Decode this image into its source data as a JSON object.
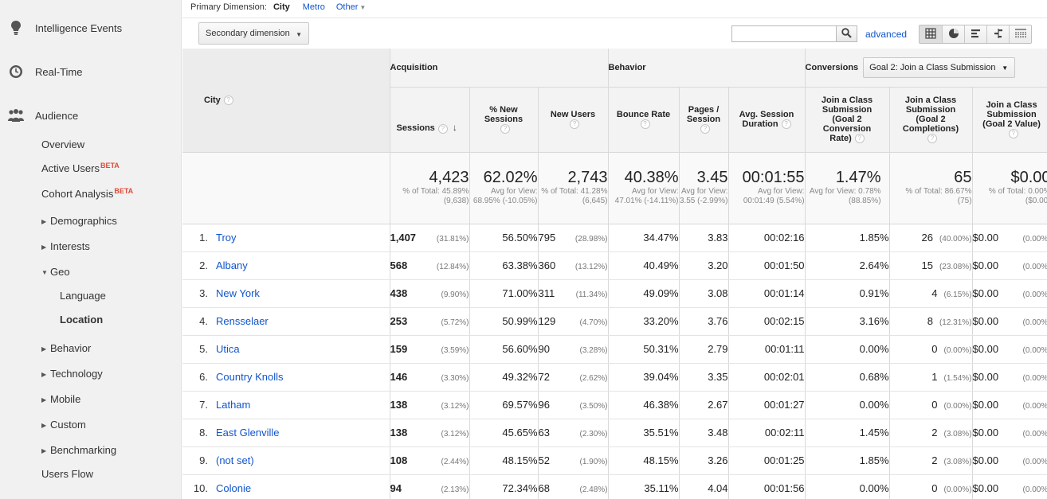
{
  "sidebar": {
    "top_items": [
      {
        "label": "Intelligence Events",
        "icon": "lightbulb-icon"
      },
      {
        "label": "Real-Time",
        "icon": "clock-icon"
      },
      {
        "label": "Audience",
        "icon": "people-icon"
      }
    ],
    "audience": {
      "overview": "Overview",
      "active_users": "Active Users",
      "cohort_analysis": "Cohort Analysis",
      "beta": "BETA",
      "demographics": "Demographics",
      "interests": "Interests",
      "geo": "Geo",
      "language": "Language",
      "location": "Location",
      "behavior": "Behavior",
      "technology": "Technology",
      "mobile": "Mobile",
      "custom": "Custom",
      "benchmarking": "Benchmarking",
      "users_flow": "Users Flow"
    }
  },
  "toolbar": {
    "primary_label": "Primary Dimension:",
    "primary_active": "City",
    "metro": "Metro",
    "other": "Other",
    "secondary_dimension": "Secondary dimension",
    "search_value": "",
    "advanced": "advanced"
  },
  "table": {
    "groups": {
      "acquisition": "Acquisition",
      "behavior": "Behavior",
      "conversions": "Conversions",
      "goal_select": "Goal 2: Join a Class Submission"
    },
    "headers": {
      "city": "City",
      "sessions": "Sessions",
      "new_sessions": "% New Sessions",
      "new_users": "New Users",
      "bounce_rate": "Bounce Rate",
      "pages_session": "Pages / Session",
      "avg_duration": "Avg. Session Duration",
      "conv_rate": "Join a Class Submission (Goal 2 Conversion Rate)",
      "completions": "Join a Class Submission (Goal 2 Completions)",
      "value": "Join a Class Submission (Goal 2 Value)"
    },
    "totals": {
      "sessions": {
        "value": "4,423",
        "sub": "% of Total: 45.89% (9,638)"
      },
      "new_sessions": {
        "value": "62.02%",
        "sub": "Avg for View: 68.95% (-10.05%)"
      },
      "new_users": {
        "value": "2,743",
        "sub": "% of Total: 41.28% (6,645)"
      },
      "bounce_rate": {
        "value": "40.38%",
        "sub": "Avg for View: 47.01% (-14.11%)"
      },
      "pages_session": {
        "value": "3.45",
        "sub": "Avg for View: 3.55 (-2.99%)"
      },
      "avg_duration": {
        "value": "00:01:55",
        "sub": "Avg for View: 00:01:49 (5.54%)"
      },
      "conv_rate": {
        "value": "1.47%",
        "sub": "Avg for View: 0.78% (88.85%)"
      },
      "completions": {
        "value": "65",
        "sub": "% of Total: 86.67% (75)"
      },
      "value": {
        "value": "$0.00",
        "sub": "% of Total: 0.00% ($0.00)"
      }
    },
    "rows": [
      {
        "rank": "1.",
        "city": "Troy",
        "sessions": "1,407",
        "sessions_pct": "(31.81%)",
        "new_sessions": "56.50%",
        "new_users": "795",
        "new_users_pct": "(28.98%)",
        "bounce": "34.47%",
        "pages": "3.83",
        "duration": "00:02:16",
        "conv": "1.85%",
        "comp": "26",
        "comp_pct": "(40.00%)",
        "val": "$0.00",
        "val_pct": "(0.00%)"
      },
      {
        "rank": "2.",
        "city": "Albany",
        "sessions": "568",
        "sessions_pct": "(12.84%)",
        "new_sessions": "63.38%",
        "new_users": "360",
        "new_users_pct": "(13.12%)",
        "bounce": "40.49%",
        "pages": "3.20",
        "duration": "00:01:50",
        "conv": "2.64%",
        "comp": "15",
        "comp_pct": "(23.08%)",
        "val": "$0.00",
        "val_pct": "(0.00%)"
      },
      {
        "rank": "3.",
        "city": "New York",
        "sessions": "438",
        "sessions_pct": "(9.90%)",
        "new_sessions": "71.00%",
        "new_users": "311",
        "new_users_pct": "(11.34%)",
        "bounce": "49.09%",
        "pages": "3.08",
        "duration": "00:01:14",
        "conv": "0.91%",
        "comp": "4",
        "comp_pct": "(6.15%)",
        "val": "$0.00",
        "val_pct": "(0.00%)"
      },
      {
        "rank": "4.",
        "city": "Rensselaer",
        "sessions": "253",
        "sessions_pct": "(5.72%)",
        "new_sessions": "50.99%",
        "new_users": "129",
        "new_users_pct": "(4.70%)",
        "bounce": "33.20%",
        "pages": "3.76",
        "duration": "00:02:15",
        "conv": "3.16%",
        "comp": "8",
        "comp_pct": "(12.31%)",
        "val": "$0.00",
        "val_pct": "(0.00%)"
      },
      {
        "rank": "5.",
        "city": "Utica",
        "sessions": "159",
        "sessions_pct": "(3.59%)",
        "new_sessions": "56.60%",
        "new_users": "90",
        "new_users_pct": "(3.28%)",
        "bounce": "50.31%",
        "pages": "2.79",
        "duration": "00:01:11",
        "conv": "0.00%",
        "comp": "0",
        "comp_pct": "(0.00%)",
        "val": "$0.00",
        "val_pct": "(0.00%)"
      },
      {
        "rank": "6.",
        "city": "Country Knolls",
        "sessions": "146",
        "sessions_pct": "(3.30%)",
        "new_sessions": "49.32%",
        "new_users": "72",
        "new_users_pct": "(2.62%)",
        "bounce": "39.04%",
        "pages": "3.35",
        "duration": "00:02:01",
        "conv": "0.68%",
        "comp": "1",
        "comp_pct": "(1.54%)",
        "val": "$0.00",
        "val_pct": "(0.00%)"
      },
      {
        "rank": "7.",
        "city": "Latham",
        "sessions": "138",
        "sessions_pct": "(3.12%)",
        "new_sessions": "69.57%",
        "new_users": "96",
        "new_users_pct": "(3.50%)",
        "bounce": "46.38%",
        "pages": "2.67",
        "duration": "00:01:27",
        "conv": "0.00%",
        "comp": "0",
        "comp_pct": "(0.00%)",
        "val": "$0.00",
        "val_pct": "(0.00%)"
      },
      {
        "rank": "8.",
        "city": "East Glenville",
        "sessions": "138",
        "sessions_pct": "(3.12%)",
        "new_sessions": "45.65%",
        "new_users": "63",
        "new_users_pct": "(2.30%)",
        "bounce": "35.51%",
        "pages": "3.48",
        "duration": "00:02:11",
        "conv": "1.45%",
        "comp": "2",
        "comp_pct": "(3.08%)",
        "val": "$0.00",
        "val_pct": "(0.00%)"
      },
      {
        "rank": "9.",
        "city": "(not set)",
        "sessions": "108",
        "sessions_pct": "(2.44%)",
        "new_sessions": "48.15%",
        "new_users": "52",
        "new_users_pct": "(1.90%)",
        "bounce": "48.15%",
        "pages": "3.26",
        "duration": "00:01:25",
        "conv": "1.85%",
        "comp": "2",
        "comp_pct": "(3.08%)",
        "val": "$0.00",
        "val_pct": "(0.00%)"
      },
      {
        "rank": "10.",
        "city": "Colonie",
        "sessions": "94",
        "sessions_pct": "(2.13%)",
        "new_sessions": "72.34%",
        "new_users": "68",
        "new_users_pct": "(2.48%)",
        "bounce": "35.11%",
        "pages": "4.04",
        "duration": "00:01:56",
        "conv": "0.00%",
        "comp": "0",
        "comp_pct": "(0.00%)",
        "val": "$0.00",
        "val_pct": "(0.00%)"
      }
    ]
  },
  "colors": {
    "link": "#1155cc",
    "beta": "#dd4b39",
    "sidebar_bg": "#f1f1f1",
    "header_bg": "#f3f3f3"
  }
}
